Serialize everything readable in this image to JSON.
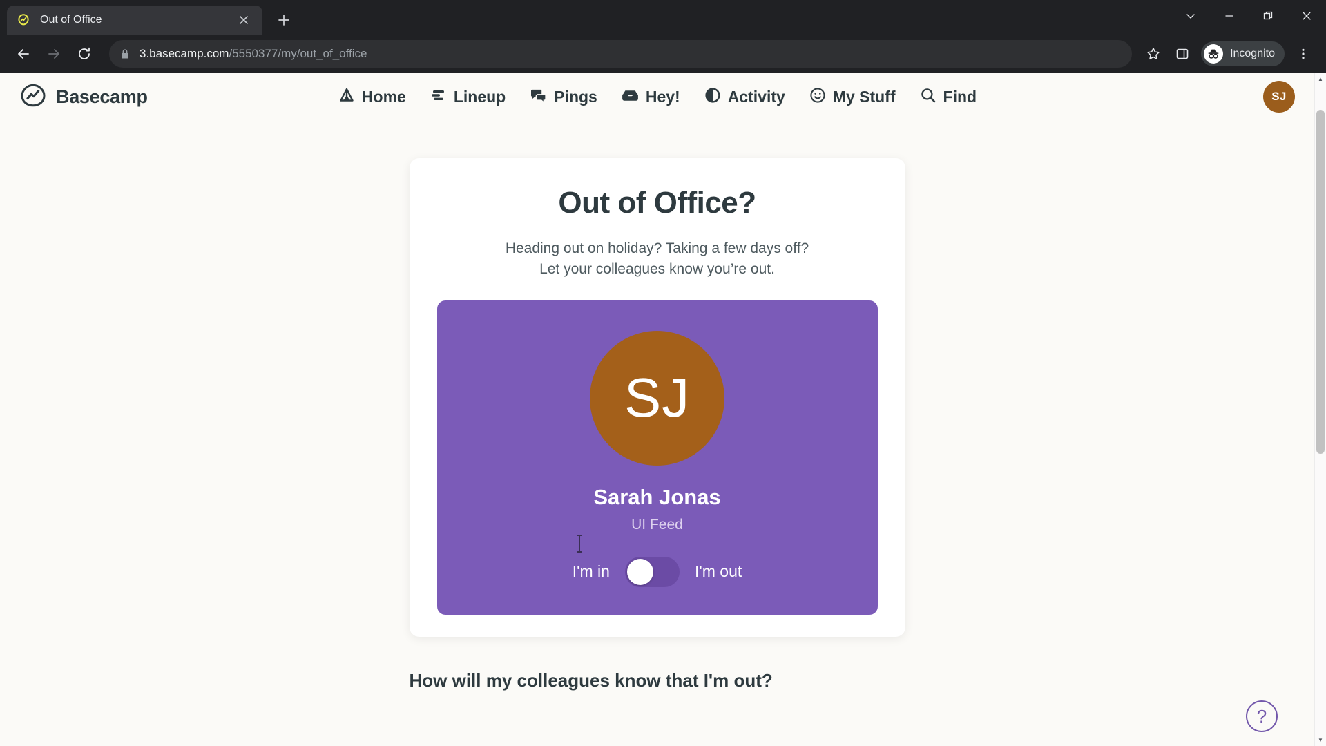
{
  "browser": {
    "tab": {
      "title": "Out of Office",
      "favicon": "basecamp-favicon",
      "close_label": "×"
    },
    "new_tab_label": "+",
    "window_controls": {
      "chevron_label": "⌄",
      "minimize_label": "—",
      "maximize_label": "❐",
      "close_label": "✕"
    },
    "toolbar": {
      "back_label": "←",
      "forward_label": "→",
      "reload_label": "↻",
      "lock_icon": "lock-icon",
      "url_host": "3.basecamp.com",
      "url_path": "/5550377/my/out_of_office",
      "bookmark_label": "☆",
      "side_panel_label": "side-panel-icon",
      "incognito_label": "Incognito",
      "menu_label": "⋮"
    }
  },
  "app": {
    "brand": "Basecamp",
    "nav": [
      {
        "label": "Home",
        "icon": "tent-icon"
      },
      {
        "label": "Lineup",
        "icon": "lineup-bars-icon"
      },
      {
        "label": "Pings",
        "icon": "chat-bubbles-icon"
      },
      {
        "label": "Hey!",
        "icon": "inbox-tray-icon"
      },
      {
        "label": "Activity",
        "icon": "pie-clock-icon"
      },
      {
        "label": "My Stuff",
        "icon": "smiley-face-icon"
      },
      {
        "label": "Find",
        "icon": "search-icon"
      }
    ],
    "account_avatar": {
      "initials": "SJ",
      "color": "#9b5d1c"
    }
  },
  "main": {
    "title": "Out of Office?",
    "subtitle_line1": "Heading out on holiday? Taking a few days off?",
    "subtitle_line2": "Let your colleagues know you’re out.",
    "status_card": {
      "background_color": "#7b5bb8",
      "avatar": {
        "initials": "SJ",
        "color": "#a4601a"
      },
      "person_name": "Sarah Jonas",
      "person_team": "UI Feed",
      "toggle": {
        "left_label": "I'm in",
        "right_label": "I'm out",
        "state": "in",
        "track_color": "#6b4ba5",
        "knob_color": "#ffffff"
      }
    },
    "below_heading": "How will my colleagues know that I'm out?"
  },
  "help": {
    "label": "?",
    "color": "#7257ab"
  },
  "scrollbar": {
    "up_arrow": "▲",
    "down_arrow": "▼"
  }
}
